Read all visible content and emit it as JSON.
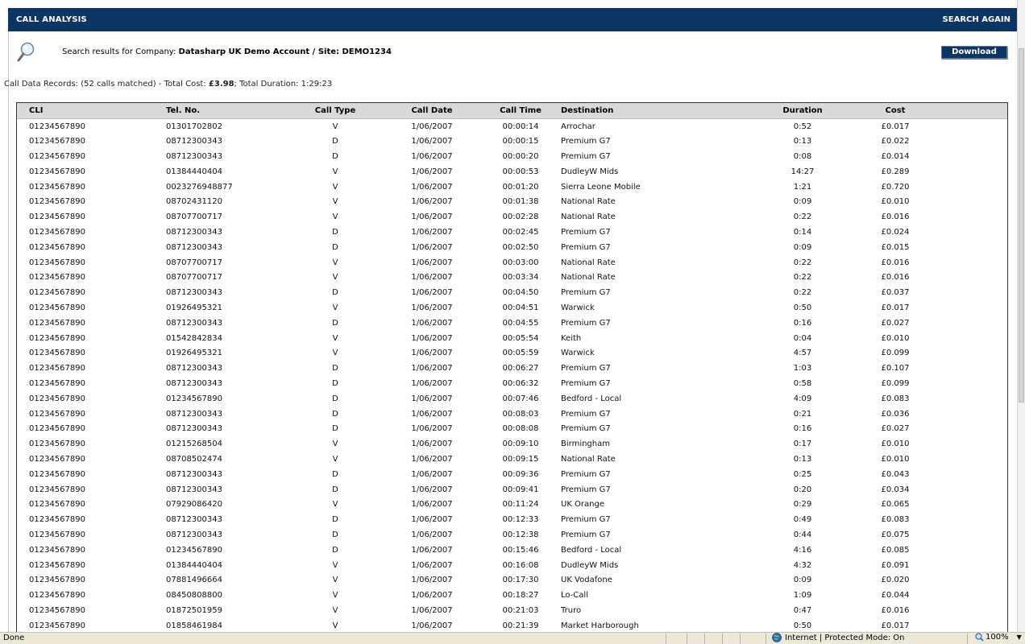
{
  "header": {
    "title": "CALL ANALYSIS",
    "search_again": "SEARCH AGAIN"
  },
  "search": {
    "prefix": "Search results for Company:",
    "company": "Datasharp UK Demo Account / Site: DEMO1234",
    "download_label": "Download"
  },
  "summary": {
    "prefix": "Call Data Records: (52 calls matched) - Total Cost:",
    "total_cost": "£3.98",
    "duration_prefix": "; Total Duration:",
    "total_duration": "1:29:23"
  },
  "table": {
    "columns": [
      "CLI",
      "Tel. No.",
      "Call Type",
      "Call Date",
      "Call Time",
      "Destination",
      "Duration",
      "Cost"
    ],
    "rows": [
      [
        "01234567890",
        "01301702802",
        "V",
        "1/06/2007",
        "00:00:14",
        "Arrochar",
        "0:52",
        "£0.017"
      ],
      [
        "01234567890",
        "08712300343",
        "D",
        "1/06/2007",
        "00:00:15",
        "Premium G7",
        "0:13",
        "£0.022"
      ],
      [
        "01234567890",
        "08712300343",
        "D",
        "1/06/2007",
        "00:00:20",
        "Premium G7",
        "0:08",
        "£0.014"
      ],
      [
        "01234567890",
        "01384440404",
        "V",
        "1/06/2007",
        "00:00:53",
        "DudleyW Mids",
        "14:27",
        "£0.289"
      ],
      [
        "01234567890",
        "0023276948877",
        "V",
        "1/06/2007",
        "00:01:20",
        "Sierra Leone Mobile",
        "1:21",
        "£0.720"
      ],
      [
        "01234567890",
        "08702431120",
        "V",
        "1/06/2007",
        "00:01:38",
        "National Rate",
        "0:09",
        "£0.010"
      ],
      [
        "01234567890",
        "08707700717",
        "V",
        "1/06/2007",
        "00:02:28",
        "National Rate",
        "0:22",
        "£0.016"
      ],
      [
        "01234567890",
        "08712300343",
        "D",
        "1/06/2007",
        "00:02:45",
        "Premium G7",
        "0:14",
        "£0.024"
      ],
      [
        "01234567890",
        "08712300343",
        "D",
        "1/06/2007",
        "00:02:50",
        "Premium G7",
        "0:09",
        "£0.015"
      ],
      [
        "01234567890",
        "08707700717",
        "V",
        "1/06/2007",
        "00:03:00",
        "National Rate",
        "0:22",
        "£0.016"
      ],
      [
        "01234567890",
        "08707700717",
        "V",
        "1/06/2007",
        "00:03:34",
        "National Rate",
        "0:22",
        "£0.016"
      ],
      [
        "01234567890",
        "08712300343",
        "D",
        "1/06/2007",
        "00:04:50",
        "Premium G7",
        "0:22",
        "£0.037"
      ],
      [
        "01234567890",
        "01926495321",
        "V",
        "1/06/2007",
        "00:04:51",
        "Warwick",
        "0:50",
        "£0.017"
      ],
      [
        "01234567890",
        "08712300343",
        "D",
        "1/06/2007",
        "00:04:55",
        "Premium G7",
        "0:16",
        "£0.027"
      ],
      [
        "01234567890",
        "01542842834",
        "V",
        "1/06/2007",
        "00:05:54",
        "Keith",
        "0:04",
        "£0.010"
      ],
      [
        "01234567890",
        "01926495321",
        "V",
        "1/06/2007",
        "00:05:59",
        "Warwick",
        "4:57",
        "£0.099"
      ],
      [
        "01234567890",
        "08712300343",
        "D",
        "1/06/2007",
        "00:06:27",
        "Premium G7",
        "1:03",
        "£0.107"
      ],
      [
        "01234567890",
        "08712300343",
        "D",
        "1/06/2007",
        "00:06:32",
        "Premium G7",
        "0:58",
        "£0.099"
      ],
      [
        "01234567890",
        "01234567890",
        "D",
        "1/06/2007",
        "00:07:46",
        "Bedford - Local",
        "4:09",
        "£0.083"
      ],
      [
        "01234567890",
        "08712300343",
        "D",
        "1/06/2007",
        "00:08:03",
        "Premium G7",
        "0:21",
        "£0.036"
      ],
      [
        "01234567890",
        "08712300343",
        "D",
        "1/06/2007",
        "00:08:08",
        "Premium G7",
        "0:16",
        "£0.027"
      ],
      [
        "01234567890",
        "01215268504",
        "V",
        "1/06/2007",
        "00:09:10",
        "Birmingham",
        "0:17",
        "£0.010"
      ],
      [
        "01234567890",
        "08708502474",
        "V",
        "1/06/2007",
        "00:09:15",
        "National Rate",
        "0:13",
        "£0.010"
      ],
      [
        "01234567890",
        "08712300343",
        "D",
        "1/06/2007",
        "00:09:36",
        "Premium G7",
        "0:25",
        "£0.043"
      ],
      [
        "01234567890",
        "08712300343",
        "D",
        "1/06/2007",
        "00:09:41",
        "Premium G7",
        "0:20",
        "£0.034"
      ],
      [
        "01234567890",
        "07929086420",
        "V",
        "1/06/2007",
        "00:11:24",
        "UK Orange",
        "0:29",
        "£0.065"
      ],
      [
        "01234567890",
        "08712300343",
        "D",
        "1/06/2007",
        "00:12:33",
        "Premium G7",
        "0:49",
        "£0.083"
      ],
      [
        "01234567890",
        "08712300343",
        "D",
        "1/06/2007",
        "00:12:38",
        "Premium G7",
        "0:44",
        "£0.075"
      ],
      [
        "01234567890",
        "01234567890",
        "D",
        "1/06/2007",
        "00:15:46",
        "Bedford - Local",
        "4:16",
        "£0.085"
      ],
      [
        "01234567890",
        "01384440404",
        "V",
        "1/06/2007",
        "00:16:08",
        "DudleyW Mids",
        "4:32",
        "£0.091"
      ],
      [
        "01234567890",
        "07881496664",
        "V",
        "1/06/2007",
        "00:17:30",
        "UK Vodafone",
        "0:09",
        "£0.020"
      ],
      [
        "01234567890",
        "08450808800",
        "V",
        "1/06/2007",
        "00:18:27",
        "Lo-Call",
        "1:09",
        "£0.044"
      ],
      [
        "01234567890",
        "01872501959",
        "V",
        "1/06/2007",
        "00:21:03",
        "Truro",
        "0:47",
        "£0.016"
      ],
      [
        "01234567890",
        "01858461984",
        "V",
        "1/06/2007",
        "00:21:39",
        "Market Harborough",
        "0:50",
        "£0.017"
      ]
    ]
  },
  "statusbar": {
    "done": "Done",
    "zone": "Internet | Protected Mode: On",
    "zoom": "100%"
  },
  "colors": {
    "header_bg": "#0d3564",
    "table_header_bg": "#d9d9d9"
  }
}
